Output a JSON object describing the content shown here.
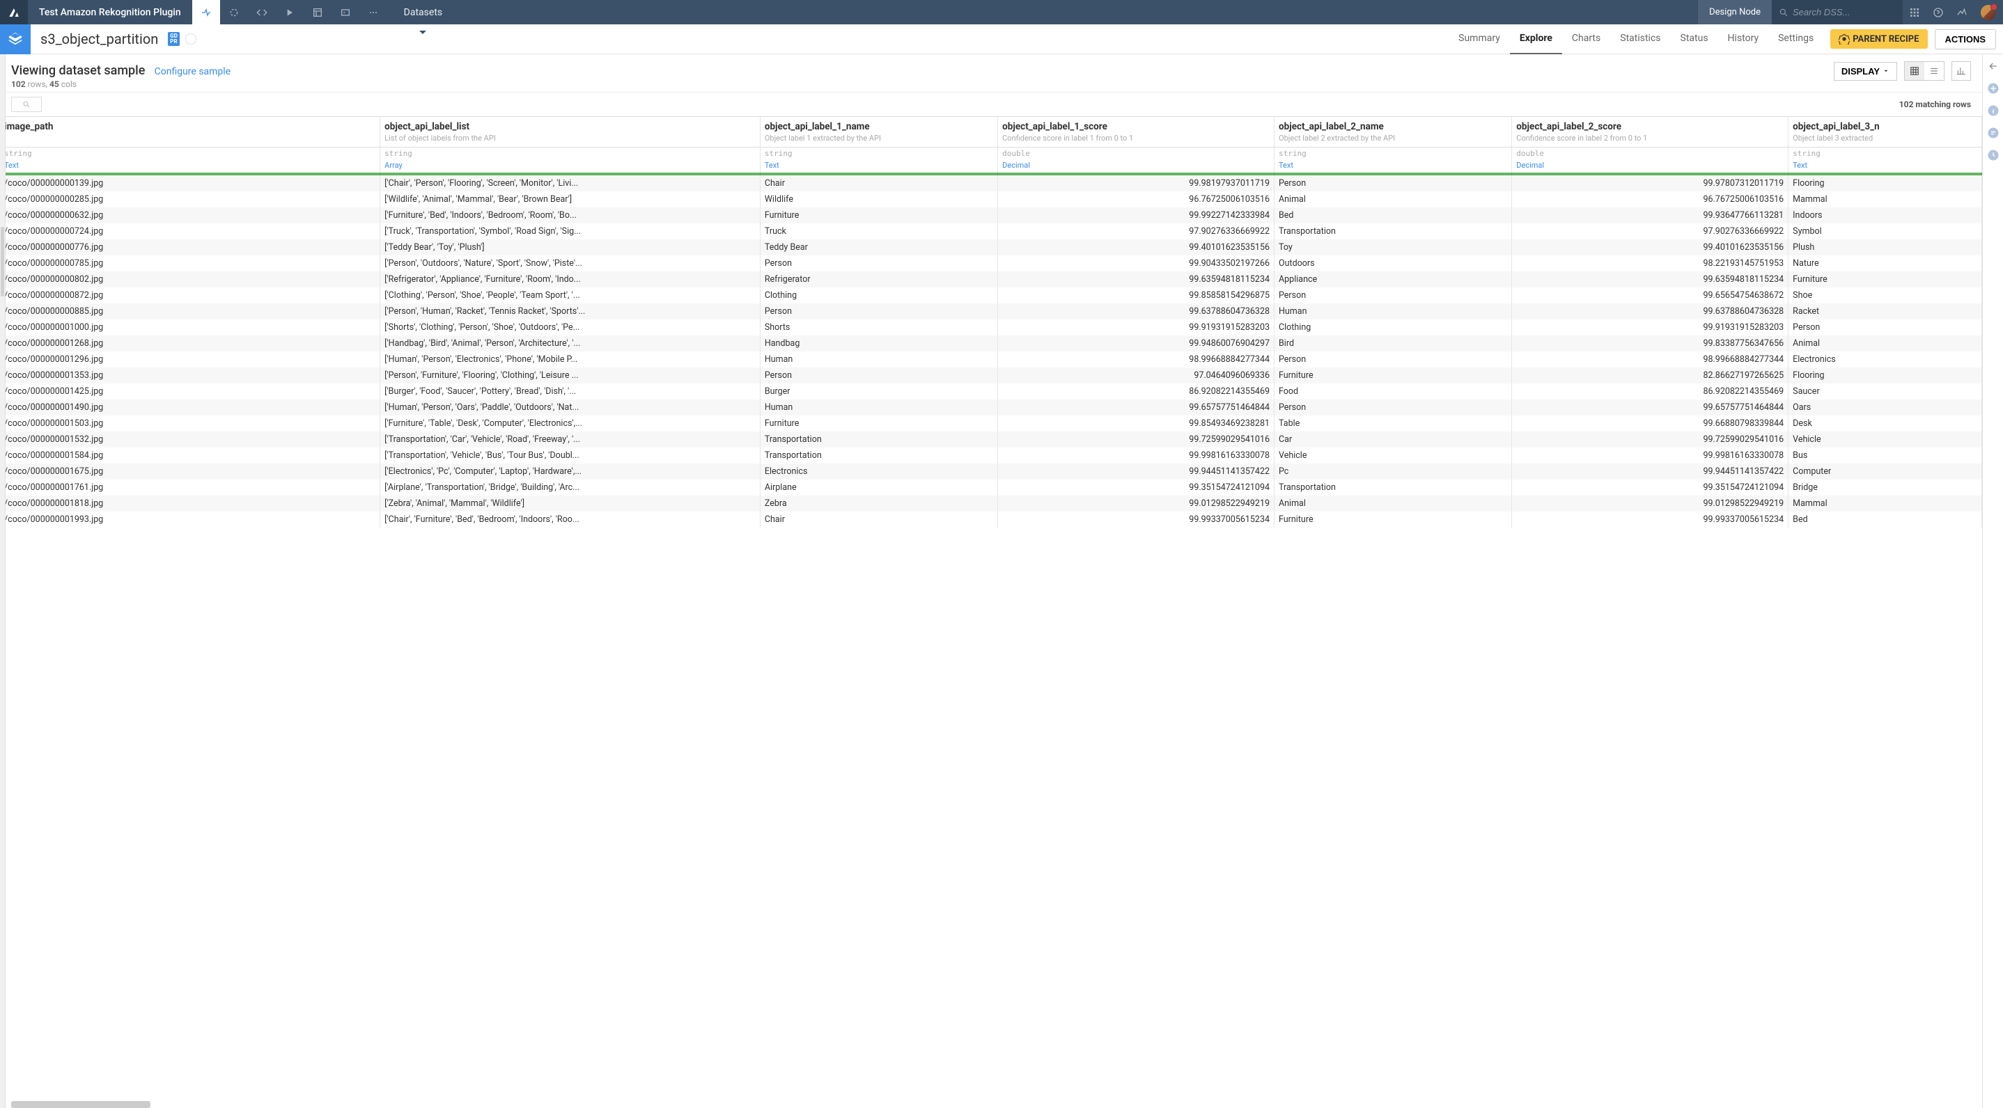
{
  "topbar": {
    "project": "Test Amazon Rekognition Plugin",
    "datasets_label": "Datasets",
    "design_node": "Design Node",
    "search_placeholder": "Search DSS..."
  },
  "subbar": {
    "title": "s3_object_partition",
    "gd_badge": "GD\nPR",
    "nav": {
      "summary": "Summary",
      "explore": "Explore",
      "charts": "Charts",
      "statistics": "Statistics",
      "status": "Status",
      "history": "History",
      "settings": "Settings"
    },
    "parent_recipe": "PARENT RECIPE",
    "actions": "ACTIONS"
  },
  "sample": {
    "heading": "Viewing dataset sample",
    "configure": "Configure sample",
    "rows": "102",
    "rows_label": " rows,  ",
    "cols": "45",
    "cols_label": " cols",
    "display": "DISPLAY",
    "matching": "102 matching rows"
  },
  "columns": [
    {
      "title": "image_path",
      "desc": "",
      "type": "string",
      "meaning": "Text",
      "cls": "col-image"
    },
    {
      "title": "object_api_label_list",
      "desc": "List of object labels from the API",
      "type": "string",
      "meaning": "Array",
      "cls": "col-list"
    },
    {
      "title": "object_api_label_1_name",
      "desc": "Object label 1 extracted by the API",
      "type": "string",
      "meaning": "Text",
      "cls": "col-l1"
    },
    {
      "title": "object_api_label_1_score",
      "desc": "Confidence score in label 1 from 0 to 1",
      "type": "double",
      "meaning": "Decimal",
      "cls": "col-s1"
    },
    {
      "title": "object_api_label_2_name",
      "desc": "Object label 2 extracted by the API",
      "type": "string",
      "meaning": "Text",
      "cls": "col-l2"
    },
    {
      "title": "object_api_label_2_score",
      "desc": "Confidence score in label 2 from 0 to 1",
      "type": "double",
      "meaning": "Decimal",
      "cls": "col-s2"
    },
    {
      "title": "object_api_label_3_n",
      "desc": "Object label 3 extracted",
      "type": "string",
      "meaning": "Text",
      "cls": "col-l3"
    }
  ],
  "rows": [
    {
      "image_path": "/coco/000000000139.jpg",
      "list": "['Chair', 'Person', 'Flooring', 'Screen', 'Monitor', 'Livi...",
      "l1": "Chair",
      "s1": "99.98197937011719",
      "l2": "Person",
      "s2": "99.97807312011719",
      "l3": "Flooring"
    },
    {
      "image_path": "/coco/000000000285.jpg",
      "list": "['Wildlife', 'Animal', 'Mammal', 'Bear', 'Brown Bear']",
      "l1": "Wildlife",
      "s1": "96.76725006103516",
      "l2": "Animal",
      "s2": "96.76725006103516",
      "l3": "Mammal"
    },
    {
      "image_path": "/coco/000000000632.jpg",
      "list": "['Furniture', 'Bed', 'Indoors', 'Bedroom', 'Room', 'Bo...",
      "l1": "Furniture",
      "s1": "99.99227142333984",
      "l2": "Bed",
      "s2": "99.93647766113281",
      "l3": "Indoors"
    },
    {
      "image_path": "/coco/000000000724.jpg",
      "list": "['Truck', 'Transportation', 'Symbol', 'Road Sign', 'Sig...",
      "l1": "Truck",
      "s1": "97.90276336669922",
      "l2": "Transportation",
      "s2": "97.90276336669922",
      "l3": "Symbol"
    },
    {
      "image_path": "/coco/000000000776.jpg",
      "list": "['Teddy Bear', 'Toy', 'Plush']",
      "l1": "Teddy Bear",
      "s1": "99.40101623535156",
      "l2": "Toy",
      "s2": "99.40101623535156",
      "l3": "Plush"
    },
    {
      "image_path": "/coco/000000000785.jpg",
      "list": "['Person', 'Outdoors', 'Nature', 'Sport', 'Snow', 'Piste'...",
      "l1": "Person",
      "s1": "99.90433502197266",
      "l2": "Outdoors",
      "s2": "98.22193145751953",
      "l3": "Nature"
    },
    {
      "image_path": "/coco/000000000802.jpg",
      "list": "['Refrigerator', 'Appliance', 'Furniture', 'Room', 'Indo...",
      "l1": "Refrigerator",
      "s1": "99.63594818115234",
      "l2": "Appliance",
      "s2": "99.63594818115234",
      "l3": "Furniture"
    },
    {
      "image_path": "/coco/000000000872.jpg",
      "list": "['Clothing', 'Person', 'Shoe', 'People', 'Team Sport', '...",
      "l1": "Clothing",
      "s1": "99.85858154296875",
      "l2": "Person",
      "s2": "99.65654754638672",
      "l3": "Shoe"
    },
    {
      "image_path": "/coco/000000000885.jpg",
      "list": "['Person', 'Human', 'Racket', 'Tennis Racket', 'Sports'...",
      "l1": "Person",
      "s1": "99.63788604736328",
      "l2": "Human",
      "s2": "99.63788604736328",
      "l3": "Racket"
    },
    {
      "image_path": "/coco/000000001000.jpg",
      "list": "['Shorts', 'Clothing', 'Person', 'Shoe', 'Outdoors', 'Pe...",
      "l1": "Shorts",
      "s1": "99.91931915283203",
      "l2": "Clothing",
      "s2": "99.91931915283203",
      "l3": "Person"
    },
    {
      "image_path": "/coco/000000001268.jpg",
      "list": "['Handbag', 'Bird', 'Animal', 'Person', 'Architecture', '...",
      "l1": "Handbag",
      "s1": "99.94860076904297",
      "l2": "Bird",
      "s2": "99.83387756347656",
      "l3": "Animal"
    },
    {
      "image_path": "/coco/000000001296.jpg",
      "list": "['Human', 'Person', 'Electronics', 'Phone', 'Mobile P...",
      "l1": "Human",
      "s1": "98.99668884277344",
      "l2": "Person",
      "s2": "98.99668884277344",
      "l3": "Electronics"
    },
    {
      "image_path": "/coco/000000001353.jpg",
      "list": "['Person', 'Furniture', 'Flooring', 'Clothing', 'Leisure ...",
      "l1": "Person",
      "s1": "97.0464096069336",
      "l2": "Furniture",
      "s2": "82.86627197265625",
      "l3": "Flooring"
    },
    {
      "image_path": "/coco/000000001425.jpg",
      "list": "['Burger', 'Food', 'Saucer', 'Pottery', 'Bread', 'Dish', '...",
      "l1": "Burger",
      "s1": "86.92082214355469",
      "l2": "Food",
      "s2": "86.92082214355469",
      "l3": "Saucer"
    },
    {
      "image_path": "/coco/000000001490.jpg",
      "list": "['Human', 'Person', 'Oars', 'Paddle', 'Outdoors', 'Nat...",
      "l1": "Human",
      "s1": "99.65757751464844",
      "l2": "Person",
      "s2": "99.65757751464844",
      "l3": "Oars"
    },
    {
      "image_path": "/coco/000000001503.jpg",
      "list": "['Furniture', 'Table', 'Desk', 'Computer', 'Electronics',...",
      "l1": "Furniture",
      "s1": "99.85493469238281",
      "l2": "Table",
      "s2": "99.66880798339844",
      "l3": "Desk"
    },
    {
      "image_path": "/coco/000000001532.jpg",
      "list": "['Transportation', 'Car', 'Vehicle', 'Road', 'Freeway', '...",
      "l1": "Transportation",
      "s1": "99.72599029541016",
      "l2": "Car",
      "s2": "99.72599029541016",
      "l3": "Vehicle"
    },
    {
      "image_path": "/coco/000000001584.jpg",
      "list": "['Transportation', 'Vehicle', 'Bus', 'Tour Bus', 'Doubl...",
      "l1": "Transportation",
      "s1": "99.99816163330078",
      "l2": "Vehicle",
      "s2": "99.99816163330078",
      "l3": "Bus"
    },
    {
      "image_path": "/coco/000000001675.jpg",
      "list": "['Electronics', 'Pc', 'Computer', 'Laptop', 'Hardware',...",
      "l1": "Electronics",
      "s1": "99.94451141357422",
      "l2": "Pc",
      "s2": "99.94451141357422",
      "l3": "Computer"
    },
    {
      "image_path": "/coco/000000001761.jpg",
      "list": "['Airplane', 'Transportation', 'Bridge', 'Building', 'Arc...",
      "l1": "Airplane",
      "s1": "99.35154724121094",
      "l2": "Transportation",
      "s2": "99.35154724121094",
      "l3": "Bridge"
    },
    {
      "image_path": "/coco/000000001818.jpg",
      "list": "['Zebra', 'Animal', 'Mammal', 'Wildlife']",
      "l1": "Zebra",
      "s1": "99.01298522949219",
      "l2": "Animal",
      "s2": "99.01298522949219",
      "l3": "Mammal"
    },
    {
      "image_path": "/coco/000000001993.jpg",
      "list": "['Chair', 'Furniture', 'Bed', 'Bedroom', 'Indoors', 'Roo...",
      "l1": "Chair",
      "s1": "99.99337005615234",
      "l2": "Furniture",
      "s2": "99.99337005615234",
      "l3": "Bed"
    }
  ]
}
